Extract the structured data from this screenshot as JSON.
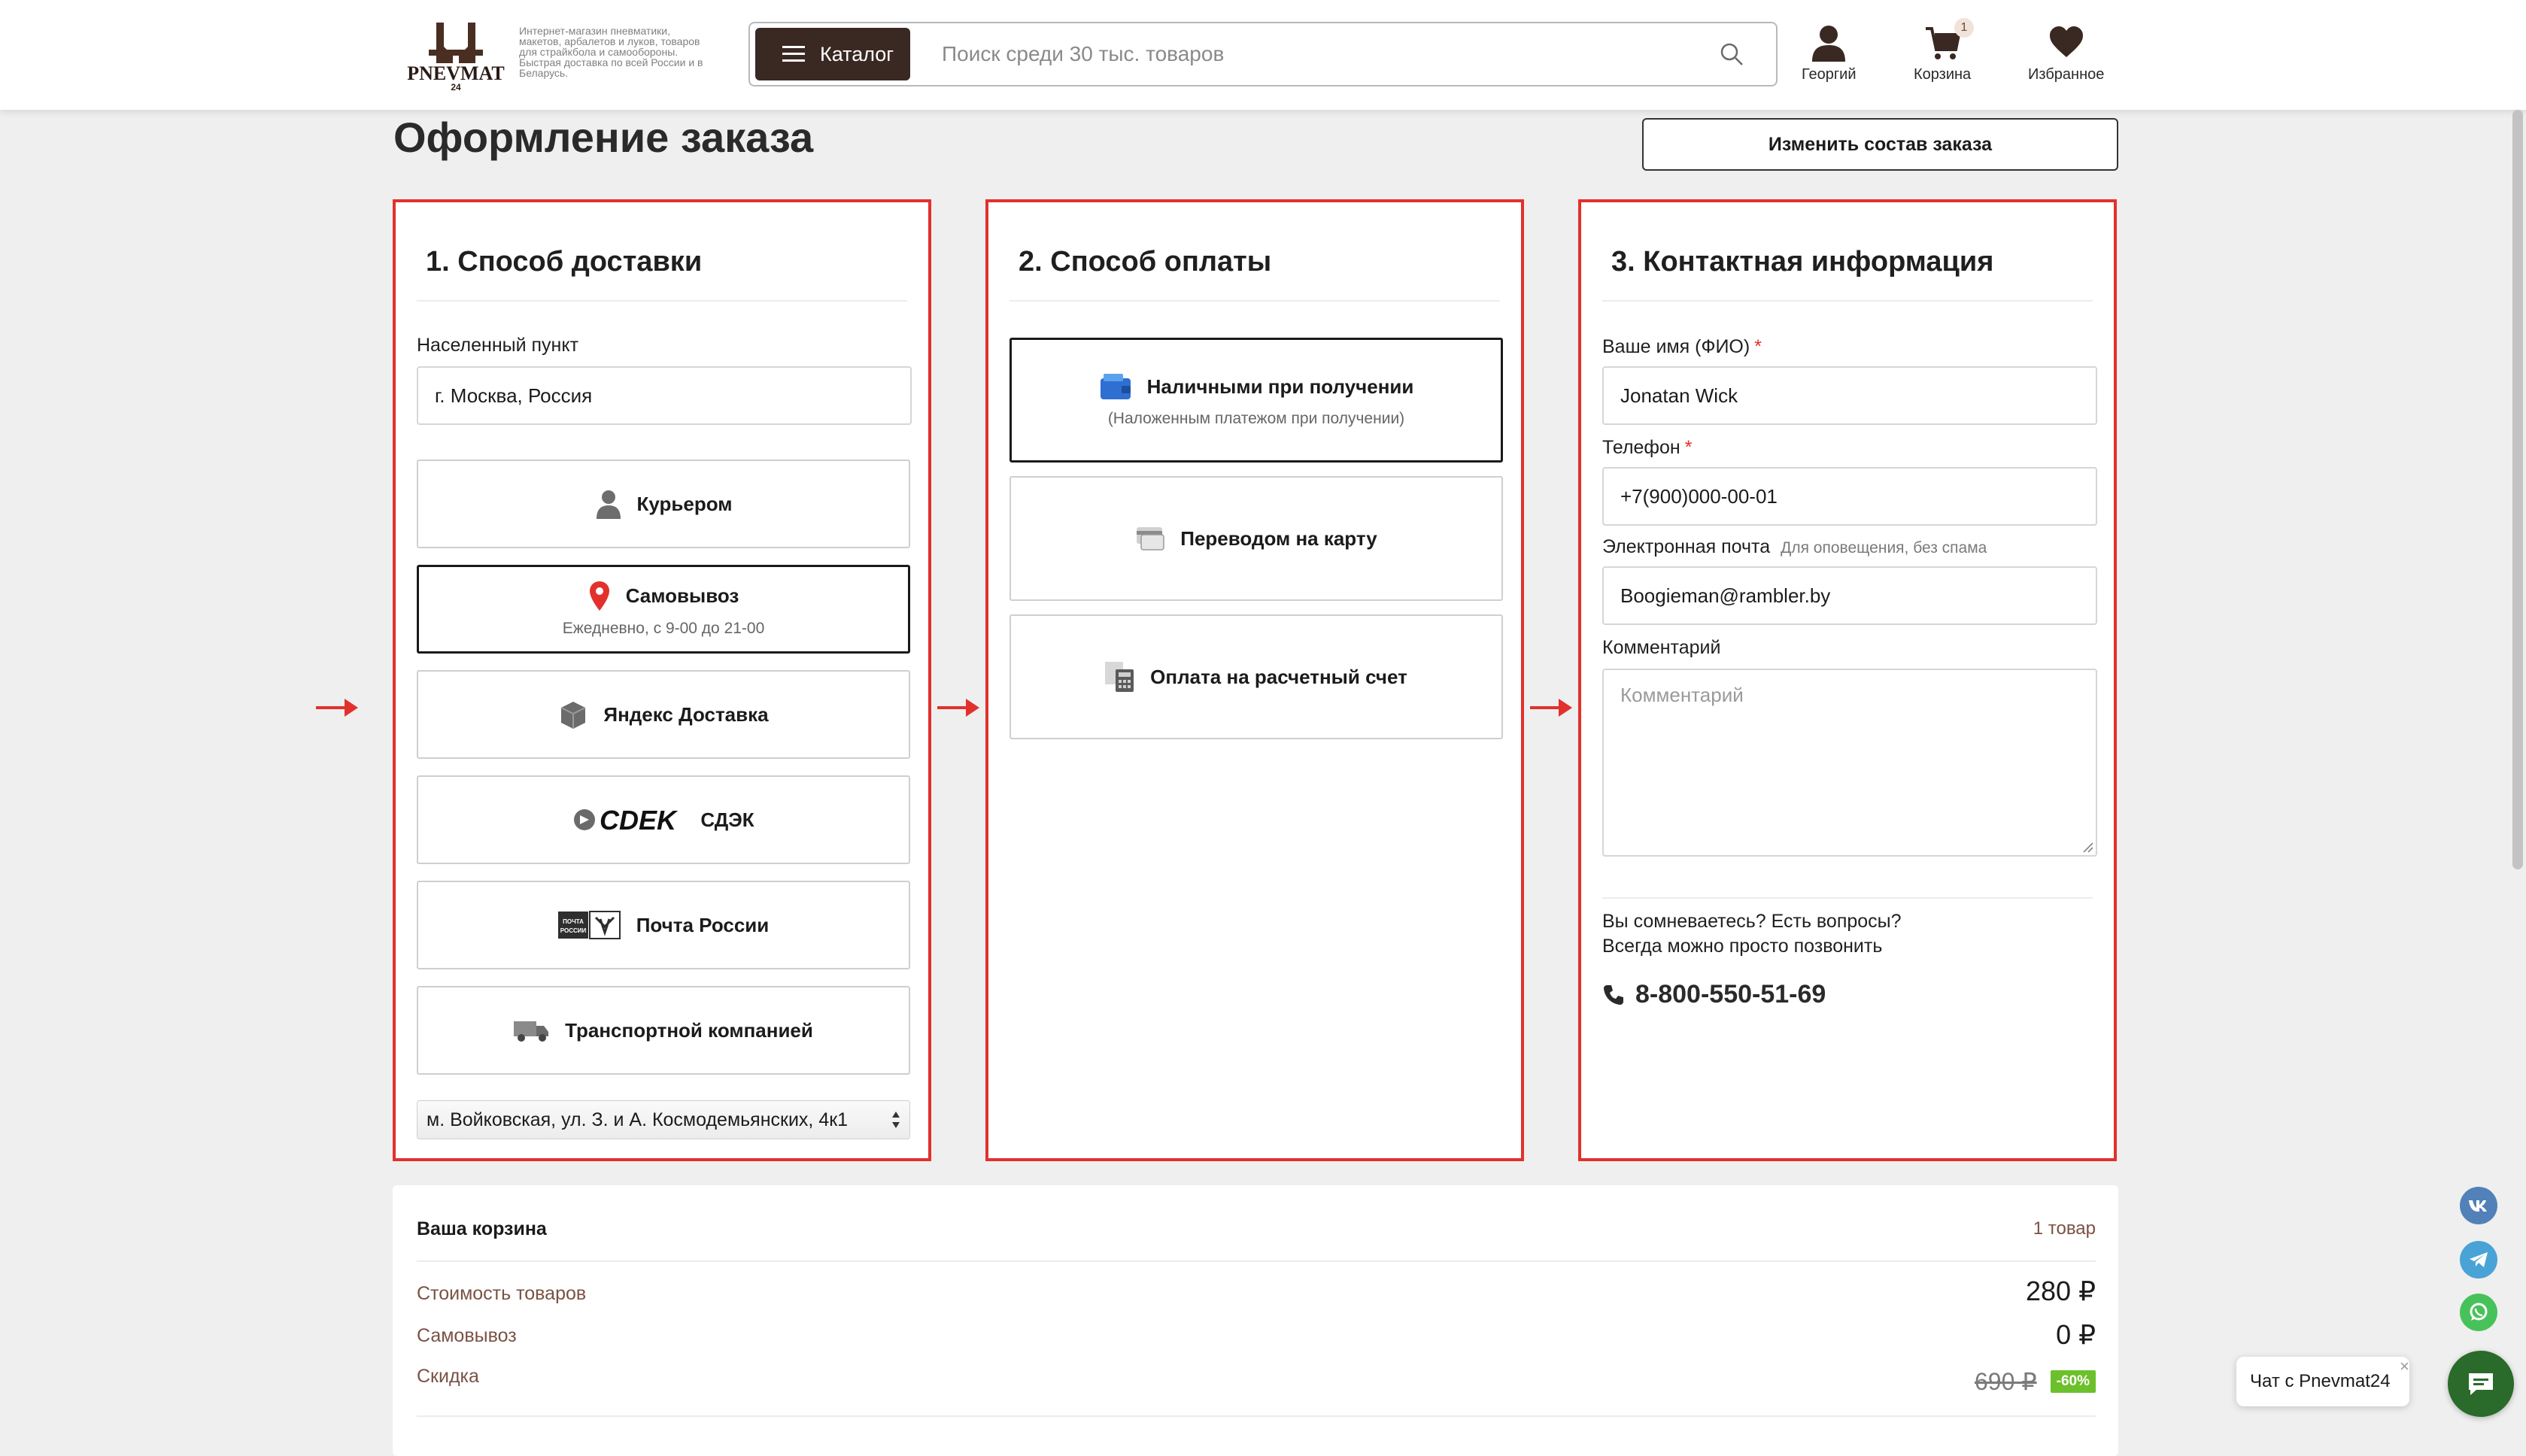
{
  "header": {
    "logo_text": "PNEVMAT",
    "logo_sub": "24",
    "tagline": "Интернет-магазин пневматики, макетов, арбалетов и луков, товаров для страйкбола и самообороны. Быстрая доставка по всей России и в Беларусь.",
    "catalog_label": "Каталог",
    "search_placeholder": "Поиск среди 30 тыс. товаров",
    "user_label": "Георгий",
    "cart_label": "Корзина",
    "cart_count": "1",
    "favorites_label": "Избранное",
    "icons": [
      "burger-icon",
      "search-icon",
      "user-icon",
      "cart-icon",
      "heart-icon"
    ]
  },
  "page": {
    "title": "Оформление заказа",
    "change_order_label": "Изменить состав заказа"
  },
  "delivery": {
    "title": "1. Способ доставки",
    "city_label": "Населенный пункт",
    "city_value": "г. Москва, Россия",
    "options": [
      {
        "label": "Курьером",
        "icon": "courier-icon",
        "selected": false
      },
      {
        "label": "Самовывоз",
        "sub": "Ежедневно, с 9-00 до 21-00",
        "icon": "map-pin-icon",
        "selected": true
      },
      {
        "label": "Яндекс Доставка",
        "icon": "box-icon",
        "selected": false
      },
      {
        "label": "СДЭК",
        "logo_text": "CDEK",
        "icon": "cdek-logo",
        "selected": false
      },
      {
        "label": "Почта России",
        "logo_text": "ПОЧТА РОССИИ",
        "icon": "russian-post-logo",
        "selected": false
      },
      {
        "label": "Транспортной компанией",
        "icon": "truck-icon",
        "selected": false
      }
    ],
    "pickup_point": "м. Войковская, ул. З. и А. Космодемьянских, 4к1"
  },
  "payment": {
    "title": "2. Способ оплаты",
    "options": [
      {
        "label": "Наличными при получении",
        "sub": "(Наложенным платежом при получении)",
        "icon": "wallet-icon",
        "selected": true
      },
      {
        "label": "Переводом на карту",
        "icon": "card-icon",
        "selected": false
      },
      {
        "label": "Оплата на расчетный счет",
        "icon": "calculator-icon",
        "selected": false
      }
    ]
  },
  "contact": {
    "title": "3. Контактная информация",
    "name_label": "Ваше имя (ФИО)",
    "name_value": "Jonatan Wick",
    "phone_label": "Телефон",
    "phone_value": "+7(900)000-00-01",
    "email_label": "Электронная почта",
    "email_hint": "Для оповещения, без спама",
    "email_value": "Boogieman@rambler.by",
    "comment_label": "Комментарий",
    "comment_placeholder": "Комментарий",
    "required_mark": "*",
    "help_line1": "Вы сомневаетесь? Есть вопросы?",
    "help_line2": "Всегда можно просто позвонить",
    "phone_number": "8-800-550-51-69"
  },
  "cart": {
    "title": "Ваша корзина",
    "count_label": "1 товар",
    "rows": [
      {
        "label": "Стоимость товаров",
        "value": "280 ₽"
      },
      {
        "label": "Самовывоз",
        "value": "0 ₽"
      },
      {
        "label": "Скидка",
        "old_value": "690 ₽",
        "badge": "-60%"
      }
    ]
  },
  "widgets": {
    "chat_label": "Чат с Pnevmat24",
    "chat_close": "×",
    "social": [
      "vk-icon",
      "telegram-icon",
      "whatsapp-icon"
    ]
  },
  "colors": {
    "accent_red": "#e2312d",
    "brand_brown": "#3a2822",
    "price_label_brown": "#7a5244",
    "discount_green": "#6cc02b",
    "chat_green": "#2a6a2a"
  }
}
